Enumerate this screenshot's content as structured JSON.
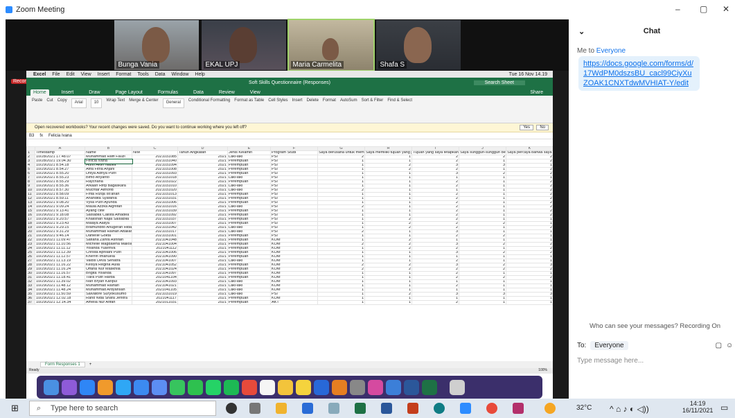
{
  "zoom": {
    "title": "Zoom Meeting",
    "min": "–",
    "restore": "▢",
    "close": "✕"
  },
  "participants": [
    "Bunga Vania",
    "EKAL UPJ",
    "Maria Carmelita",
    "Shafa S"
  ],
  "mac": {
    "apple": "",
    "app": "Excel",
    "menus": [
      "File",
      "Edit",
      "View",
      "Insert",
      "Format",
      "Tools",
      "Data",
      "Window",
      "Help"
    ],
    "clock": "Tue 16 Nov 14.19",
    "recording": "Recording"
  },
  "excel": {
    "title": "Soft Skills Questionnaire (Responses)",
    "search": "Search Sheet",
    "share": "Share",
    "tabs": [
      "Home",
      "Insert",
      "Draw",
      "Page Layout",
      "Formulas",
      "Data",
      "Review",
      "View"
    ],
    "ribbon": {
      "paste": "Paste",
      "cut": "Cut",
      "copy": "Copy",
      "format": "Format",
      "font": "Arial",
      "size": "10",
      "wrap": "Wrap Text",
      "merge": "Merge & Center",
      "numfmt": "General",
      "cond": "Conditional Formatting",
      "fmt_table": "Format as Table",
      "styles": "Cell Styles",
      "insert": "Insert",
      "delete": "Delete",
      "fmt": "Format",
      "autosum": "AutoSum",
      "fill": "Fill",
      "clear": "Clear",
      "sort": "Sort & Filter",
      "find": "Find & Select"
    },
    "notice": "Open recovered workbooks? Your recent changes were saved. Do you want to continue working where you left off?",
    "yes": "Yes",
    "no": "No",
    "cellref": "B3",
    "formula": "Felicia Ivana",
    "cols": [
      "",
      "A",
      "B",
      "C",
      "D",
      "E",
      "F",
      "G",
      "H",
      "I",
      "J",
      "K"
    ],
    "headers": [
      "1",
      "Timestamp",
      "Name",
      "NIM",
      "Tahun Angkatan",
      "Jenis Kelamin",
      "Program Studi",
      "Saya berusaha untuk mem",
      "Saya memiliki tujuan yang j",
      "Tujuan yang saya tetapkan",
      "Saya sungguh-sungguh be",
      "Saya percaya bahwa saya"
    ],
    "rows": [
      [
        "2",
        "10/28/2021 17.48.07",
        "Muhammad Raffi Fauzi",
        "2021031085",
        "2021",
        "Laki-laki",
        "PSI",
        "2",
        "1",
        "2",
        "2",
        "2"
      ],
      [
        "3",
        "10/28/2021 19.04.30",
        "Felicia Ivana",
        "2021031040",
        "2021",
        "Perempuan",
        "PSI",
        "1",
        "1",
        "2",
        "1",
        "2"
      ],
      [
        "4",
        "10/29/2021 8.54.18",
        "Hurin Akiin Nabila",
        "2021031094",
        "2021",
        "Perempuan",
        "PSI",
        "1",
        "2",
        "3",
        "3",
        "1"
      ],
      [
        "5",
        "10/29/2021 8.54.27",
        "Afifa Fitria Anjani",
        "2021031008",
        "2021",
        "Perempuan",
        "PSI",
        "1",
        "2",
        "2",
        "1",
        "2"
      ],
      [
        "6",
        "10/29/2021 8.55.20",
        "Dhiya Adhya Putri",
        "2021031093",
        "2021",
        "Perempuan",
        "PSI",
        "1",
        "1",
        "3",
        "2",
        "2"
      ],
      [
        "7",
        "10/29/2021 8.55.23",
        "Bimo Ariyanto",
        "2021031018",
        "2021",
        "Laki-laki",
        "PSI",
        "1",
        "1",
        "1",
        "1",
        "1"
      ],
      [
        "8",
        "10/29/2021 8.55.29",
        "Raychana",
        "2021031022",
        "2021",
        "Perempuan",
        "PSI",
        "1",
        "1",
        "2",
        "1",
        "2"
      ],
      [
        "9",
        "10/29/2021 8.55.36",
        "Arkaan Rifqi Bagaskara",
        "2021031010",
        "2021",
        "Laki-laki",
        "PSI",
        "1",
        "1",
        "2",
        "1",
        "2"
      ],
      [
        "10",
        "10/29/2021 8.57.30",
        "Muchtar Althorid",
        "2021031020",
        "2021",
        "Laki-laki",
        "PSI",
        "2",
        "1",
        "1",
        "1",
        "2"
      ],
      [
        "11",
        "10/29/2021 8.58.09",
        "Finta Rizqa Ist'anah",
        "2021031013",
        "2021",
        "Perempuan",
        "PSI",
        "1",
        "1",
        "2",
        "1",
        "2"
      ],
      [
        "12",
        "10/29/2021 8.59.11",
        "Anandita Syafania",
        "2021031031",
        "2021",
        "Perempuan",
        "PSI",
        "1",
        "1",
        "2",
        "1",
        "2"
      ],
      [
        "13",
        "10/29/2021 9.08.20",
        "Vysa Putri Ayunda",
        "2021031006",
        "2021",
        "Perempuan",
        "PSI",
        "1",
        "1",
        "2",
        "1",
        "2"
      ],
      [
        "14",
        "10/29/2021 9.09.24",
        "Maula Azzka Alghifari",
        "2021031016",
        "2021",
        "Laki-laki",
        "PSI",
        "2",
        "1",
        "2",
        "1",
        "2"
      ],
      [
        "15",
        "10/29/2021 9.13.41",
        "Ayang clite",
        "2021031039",
        "2021",
        "Perempuan",
        "PSI",
        "1",
        "1",
        "2",
        "1",
        "2"
      ],
      [
        "16",
        "10/29/2021 9.18.08",
        "Salsabila Calista Amadea",
        "2021031092",
        "2021",
        "Perempuan",
        "PSI",
        "1",
        "1",
        "2",
        "1",
        "2"
      ],
      [
        "17",
        "10/29/2021 9.20.57",
        "Khalishah Najla Salsabila",
        "2021031037",
        "2021",
        "Perempuan",
        "PSI",
        "1",
        "2",
        "2",
        "1",
        "1"
      ],
      [
        "18",
        "10/29/2021 9.23.43",
        "Malaya Aaliya",
        "2021031007",
        "2021",
        "Perempuan",
        "PSI",
        "1",
        "2",
        "2",
        "2",
        "1"
      ],
      [
        "19",
        "10/29/2021 9.29.15",
        "Bramundito Anugerah Hida",
        "2021031042",
        "2021",
        "Laki-laki",
        "PSI",
        "1",
        "2",
        "2",
        "1",
        "2"
      ],
      [
        "20",
        "10/29/2021 9.31.29",
        "Muhammad Raihan Attallah",
        "2021031017",
        "2021",
        "Laki-laki",
        "PSI",
        "2",
        "1",
        "3",
        "1",
        "1"
      ],
      [
        "21",
        "10/29/2021 9.46.14",
        "Danielle Gokta",
        "2021031001",
        "2021",
        "Perempuan",
        "PSI",
        "1",
        "1",
        "2",
        "2",
        "1"
      ],
      [
        "22",
        "10/29/2021 11.09.47",
        "Safiana Zahra Asnifah",
        "2021041048",
        "2021",
        "Perempuan",
        "KOM",
        "1",
        "2",
        "1",
        "1",
        "1"
      ],
      [
        "23",
        "10/29/2021 11.10.56",
        "Michelle Magdalena Malloa",
        "2021041004",
        "2021",
        "Perempuan",
        "KOM",
        "2",
        "2",
        "3",
        "2",
        "2"
      ],
      [
        "24",
        "10/29/2021 11.11.12",
        "Yolanda Yuarinva",
        "2021041112",
        "2021",
        "Perempuan",
        "KOM",
        "1",
        "2",
        "2",
        "1",
        "2"
      ],
      [
        "25",
        "10/29/2021 11.12.39",
        "Christa Apriliani Putri",
        "2021041006",
        "2021",
        "Perempuan",
        "KOM",
        "1",
        "1",
        "3",
        "2",
        "2"
      ],
      [
        "26",
        "10/29/2021 11.12.57",
        "Kherrin Imanuela",
        "2021041090",
        "2021",
        "Perempuan",
        "KOM",
        "1",
        "1",
        "1",
        "1",
        "1"
      ],
      [
        "27",
        "10/29/2021 11.13.19",
        "Valdis Deva Senatra",
        "2021041007",
        "2021",
        "Laki-laki",
        "KOM",
        "1",
        "1",
        "2",
        "1",
        "1"
      ],
      [
        "28",
        "10/29/2021 11.16.22",
        "Keisya Regina Aulia",
        "2021041052",
        "2021",
        "Perempuan",
        "KOM",
        "2",
        "2",
        "3",
        "2",
        "3"
      ],
      [
        "29",
        "10/29/2021 11.16.24",
        "Uffana Nur Maskhila",
        "2021041024",
        "2021",
        "Perempuan",
        "KOM",
        "2",
        "2",
        "2",
        "2",
        "2"
      ],
      [
        "30",
        "10/29/2021 11.16.57",
        "Brigita Yolanda",
        "2021041097",
        "2021",
        "Perempuan",
        "KOM",
        "1",
        "1",
        "2",
        "1",
        "1"
      ],
      [
        "31",
        "10/29/2021 11.18.41",
        "Tiara Putri Harda",
        "2021041104",
        "2021",
        "Perempuan",
        "KOM",
        "1",
        "1",
        "2",
        "2",
        "2"
      ],
      [
        "32",
        "10/29/2021 11.39.02",
        "Ivan Bryan Karipui",
        "2021041093",
        "2021",
        "Laki-laki",
        "KOM",
        "1",
        "1",
        "1",
        "1",
        "1"
      ],
      [
        "33",
        "10/29/2021 11.48.12",
        "Muhammad Raihan",
        "2021041021",
        "2021",
        "Laki-laki",
        "KOM",
        "1",
        "1",
        "2",
        "1",
        "1"
      ],
      [
        "34",
        "10/29/2021 11.48.24",
        "Muhammad Ardyansah",
        "2021041105",
        "2021",
        "Laki-laki",
        "KOM",
        "1",
        "1",
        "1",
        "1",
        "1"
      ],
      [
        "35",
        "10/29/2021 11.50.59",
        "Salvatore Suryokusumo",
        "2021031019",
        "2021",
        "Laki-laki",
        "PSI",
        "1",
        "2",
        "3",
        "3",
        "3"
      ],
      [
        "36",
        "10/29/2021 12.02.18",
        "Rand Nida Shafa Jenitra",
        "2021041117",
        "2021",
        "Perempuan",
        "KOM",
        "1",
        "1",
        "1",
        "1",
        "1"
      ],
      [
        "37",
        "10/29/2021 12.14.34",
        "Amelia Nur Afifah",
        "2021011031",
        "2021",
        "Perempuan",
        "AKT",
        "1",
        "1",
        "2",
        "1",
        "1"
      ]
    ],
    "sheet": "Form Responses 1",
    "add": "+",
    "ready": "Ready",
    "zoom": "100%"
  },
  "chat": {
    "title": "Chat",
    "from": "Me to",
    "to_name": "Everyone",
    "link": "https://docs.google.com/forms/d/17WdPM0dszsBU_cacl99CiyXuZOAK1CNXTdwMVHIAT-Y/edit",
    "who": "Who can see your messages? Recording On",
    "to_label": "To:",
    "to_sel": "Everyone",
    "placeholder": "Type message here..."
  },
  "taskbar": {
    "search": "Type here to search",
    "temp": "32°C",
    "time": "14:19",
    "date": "16/11/2021"
  }
}
